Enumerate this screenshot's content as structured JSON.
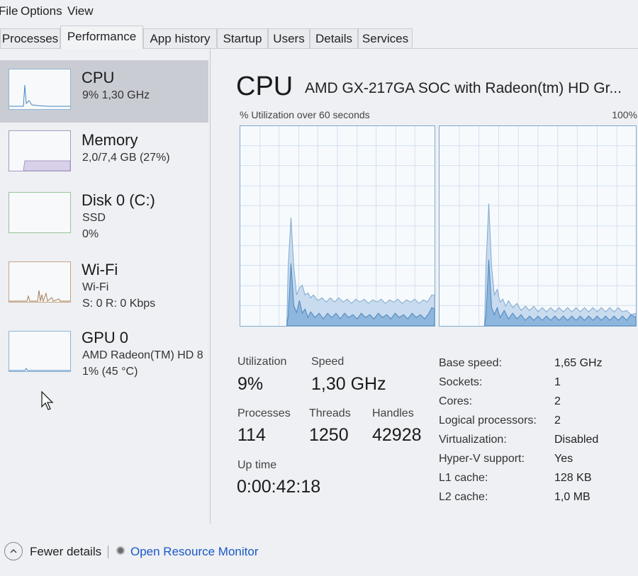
{
  "menu": [
    "File",
    "Options",
    "View"
  ],
  "tabs": [
    "Processes",
    "Performance",
    "App history",
    "Startup",
    "Users",
    "Details",
    "Services"
  ],
  "active_tab": "Performance",
  "sidebar": {
    "items": [
      {
        "title": "CPU",
        "sub1": "9%  1,30 GHz"
      },
      {
        "title": "Memory",
        "sub1": "2,0/7,4 GB (27%)"
      },
      {
        "title": "Disk 0 (C:)",
        "sub1": "SSD",
        "sub2": "0%"
      },
      {
        "title": "Wi-Fi",
        "sub1": "Wi-Fi",
        "sub2": "S: 0 R: 0 Kbps"
      },
      {
        "title": "GPU 0",
        "sub1": "AMD Radeon(TM) HD 8",
        "sub2": "1%  (45 °C)"
      }
    ]
  },
  "main": {
    "title": "CPU",
    "cpu_name": "AMD GX-217GA SOC with Radeon(tm) HD Gr...",
    "graph_label": "% Utilization over 60 seconds",
    "graph_max": "100%",
    "stats": {
      "utilization_label": "Utilization",
      "utilization": "9%",
      "speed_label": "Speed",
      "speed": "1,30 GHz",
      "processes_label": "Processes",
      "processes": "114",
      "threads_label": "Threads",
      "threads": "1250",
      "handles_label": "Handles",
      "handles": "42928",
      "uptime_label": "Up time",
      "uptime": "0:00:42:18"
    },
    "properties": [
      {
        "label": "Base speed:",
        "value": "1,65 GHz"
      },
      {
        "label": "Sockets:",
        "value": "1"
      },
      {
        "label": "Cores:",
        "value": "2"
      },
      {
        "label": "Logical processors:",
        "value": "2"
      },
      {
        "label": "Virtualization:",
        "value": "Disabled"
      },
      {
        "label": "Hyper-V support:",
        "value": "Yes"
      },
      {
        "label": "L1 cache:",
        "value": "128 KB"
      },
      {
        "label": "L2 cache:",
        "value": "1,0 MB"
      }
    ]
  },
  "footer": {
    "fewer_details": "Fewer details",
    "open_resource_monitor": "Open Resource Monitor"
  },
  "colors": {
    "graph_line": "#4a86c0",
    "graph_fill": "#8fb6dc",
    "link": "#1a57c7",
    "selected_bg": "#c9ccd3"
  }
}
